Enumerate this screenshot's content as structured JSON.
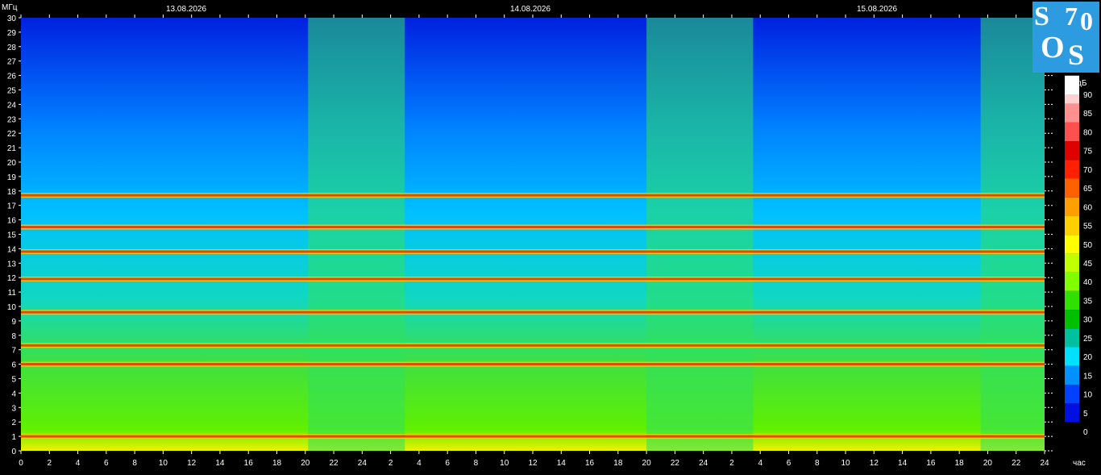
{
  "chart_data": {
    "type": "heatmap",
    "title": "",
    "ylabel": "МГц",
    "xlabel": "час",
    "colorbar_label": "дБ",
    "dates": [
      "13.08.2026",
      "14.08.2026",
      "15.08.2026"
    ],
    "y_ticks": [
      0,
      1,
      2,
      3,
      4,
      5,
      6,
      7,
      8,
      9,
      10,
      11,
      12,
      13,
      14,
      15,
      16,
      17,
      18,
      19,
      20,
      21,
      22,
      23,
      24,
      25,
      26,
      27,
      28,
      29,
      30
    ],
    "ylim": [
      0,
      30
    ],
    "x_tick_labels": [
      "0",
      "2",
      "4",
      "6",
      "8",
      "10",
      "12",
      "14",
      "16",
      "18",
      "20",
      "22",
      "24",
      "2",
      "4",
      "6",
      "8",
      "10",
      "12",
      "14",
      "16",
      "18",
      "20",
      "22",
      "24",
      "2",
      "4",
      "6",
      "8",
      "10",
      "12",
      "14",
      "16",
      "18",
      "20",
      "22",
      "24"
    ],
    "x_hours_total": 72,
    "colorbar_ticks": [
      0,
      5,
      10,
      15,
      20,
      25,
      30,
      35,
      40,
      45,
      50,
      55,
      60,
      65,
      70,
      75,
      80,
      85,
      90
    ],
    "colorbar_colors": [
      "#0010e0",
      "#0040ff",
      "#0090ff",
      "#00e0ff",
      "#00c0a0",
      "#00c000",
      "#30e000",
      "#80ff00",
      "#c0ff00",
      "#ffff00",
      "#ffd000",
      "#ffa000",
      "#ff6000",
      "#ff2000",
      "#e00000",
      "#ff5050",
      "#ff9090",
      "#ffd0d0",
      "#ffffff"
    ],
    "strong_bands_mhz": [
      1,
      6,
      7.3,
      9.6,
      11.9,
      13.8,
      15.5,
      17.7
    ],
    "grid": false,
    "colorbar_position": "right"
  },
  "logo": {
    "letters": [
      "S",
      "7",
      "0",
      "O",
      "S"
    ]
  }
}
